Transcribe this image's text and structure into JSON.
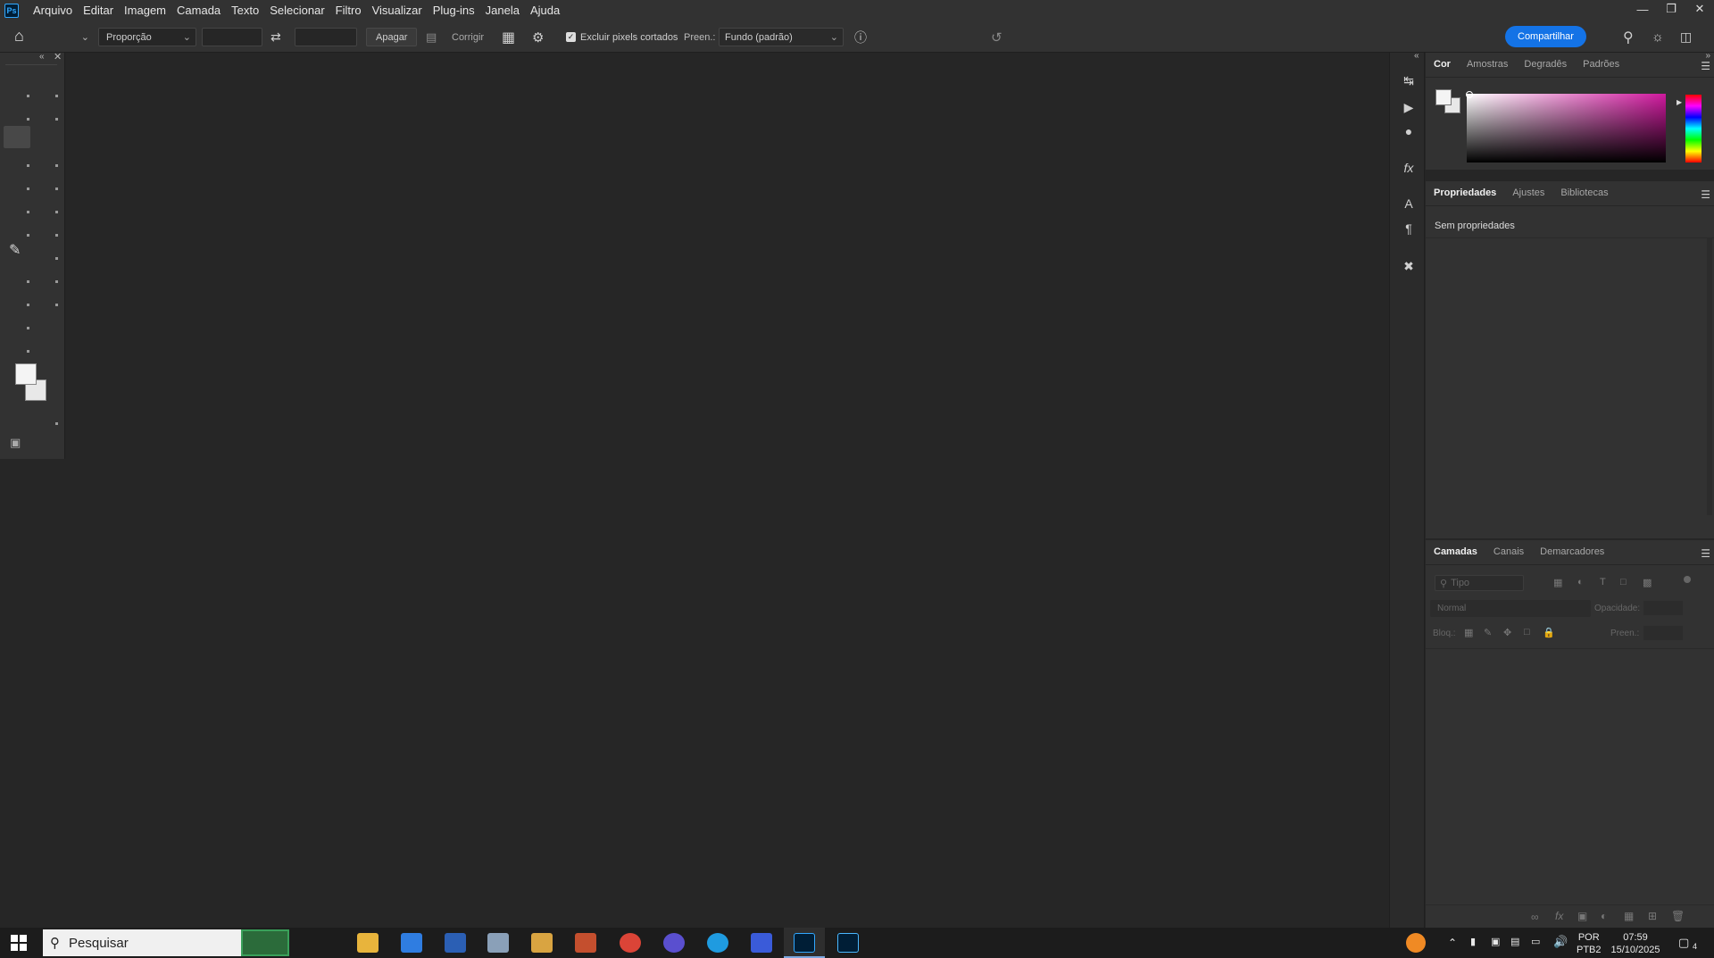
{
  "app": {
    "logo_text": "Ps",
    "menus": [
      "Arquivo",
      "Editar",
      "Imagem",
      "Camada",
      "Texto",
      "Selecionar",
      "Filtro",
      "Visualizar",
      "Plug-ins",
      "Janela",
      "Ajuda"
    ]
  },
  "options": {
    "ratio_select": "Proporção",
    "clear_button": "Apagar",
    "straighten_label": "Corrigir",
    "delete_cropped_label": "Excluir pixels cortados",
    "delete_cropped_checked": true,
    "fill_label": "Preen.:",
    "fill_value": "Fundo (padrão)",
    "share_button": "Compartilhar"
  },
  "color_panel": {
    "tabs": [
      "Cor",
      "Amostras",
      "Degradês",
      "Padrões"
    ],
    "active_tab": "Cor",
    "picker_hue_color": "#d0199e"
  },
  "properties_panel": {
    "tabs": [
      "Propriedades",
      "Ajustes",
      "Bibliotecas"
    ],
    "active_tab": "Propriedades",
    "empty_text": "Sem propriedades"
  },
  "layers_panel": {
    "tabs": [
      "Camadas",
      "Canais",
      "Demarcadores"
    ],
    "active_tab": "Camadas",
    "filter_placeholder": "Tipo",
    "blend_mode": "Normal",
    "opacity_label": "Opacidade:",
    "lock_label": "Bloq.:",
    "fill_label": "Preen.:"
  },
  "taskbar": {
    "search_placeholder": "Pesquisar",
    "language_line1": "POR",
    "language_line2": "PTB2",
    "time": "07:59",
    "date": "15/10/2025",
    "notification_count": "4"
  }
}
